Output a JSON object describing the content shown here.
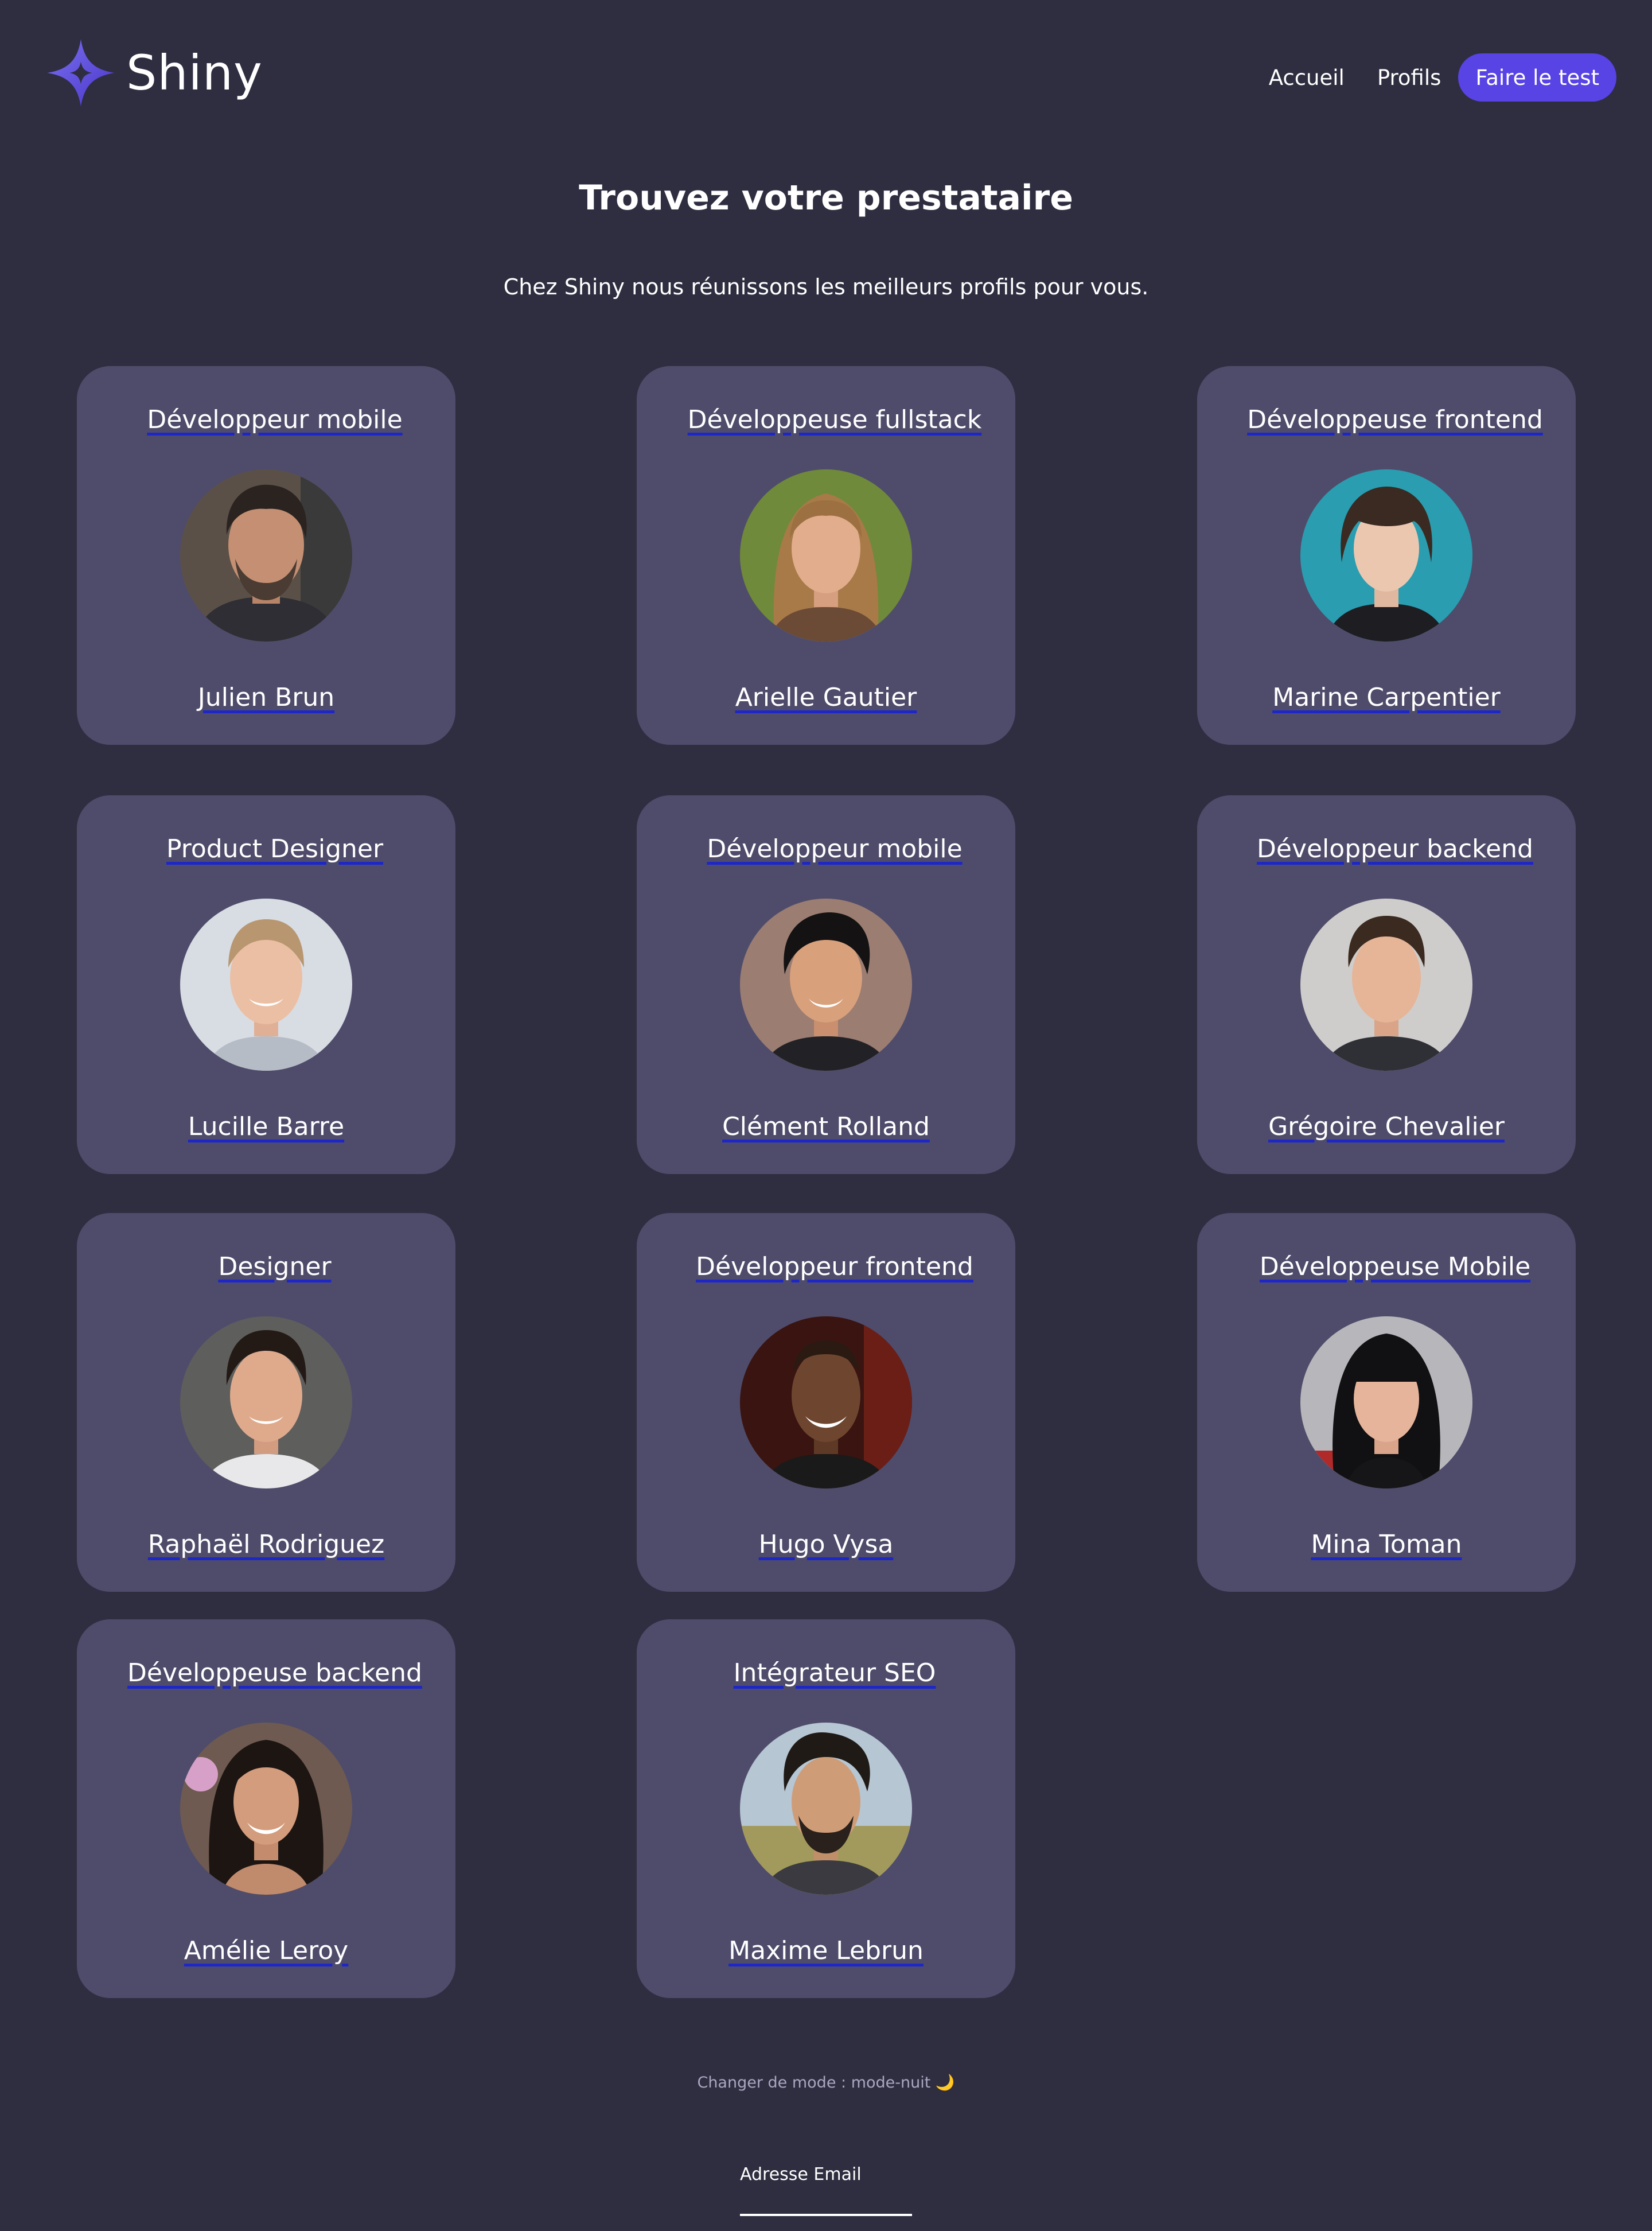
{
  "header": {
    "logo_text": "Shiny",
    "nav": {
      "home": "Accueil",
      "profiles": "Profils",
      "cta": "Faire le test"
    }
  },
  "main": {
    "title": "Trouvez votre prestataire",
    "subtitle": "Chez Shiny nous réunissons les meilleurs profils pour vous.",
    "profiles": [
      {
        "job": "Développeur mobile",
        "name": "Julien Brun"
      },
      {
        "job": "Développeuse fullstack",
        "name": "Arielle Gautier"
      },
      {
        "job": "Développeuse frontend",
        "name": "Marine Carpentier"
      },
      {
        "job": "Product Designer",
        "name": "Lucille Barre"
      },
      {
        "job": "Développeur mobile",
        "name": "Clément Rolland"
      },
      {
        "job": "Développeur backend",
        "name": "Grégoire Chevalier"
      },
      {
        "job": "Designer",
        "name": "Raphaël Rodriguez"
      },
      {
        "job": "Développeur frontend",
        "name": "Hugo Vysa"
      },
      {
        "job": "Développeuse Mobile",
        "name": "Mina Toman"
      },
      {
        "job": "Développeuse backend",
        "name": "Amélie Leroy"
      },
      {
        "job": "Intégrateur SEO",
        "name": "Maxime Lebrun"
      }
    ]
  },
  "footer": {
    "mode_toggle": "Changer de mode : mode-nuit 🌙",
    "email_label": "Adresse Email"
  },
  "colors": {
    "background": "#2f2e41",
    "card": "#4f4c6b",
    "accent": "#5843e4",
    "link_underline": "#1c26c9"
  }
}
